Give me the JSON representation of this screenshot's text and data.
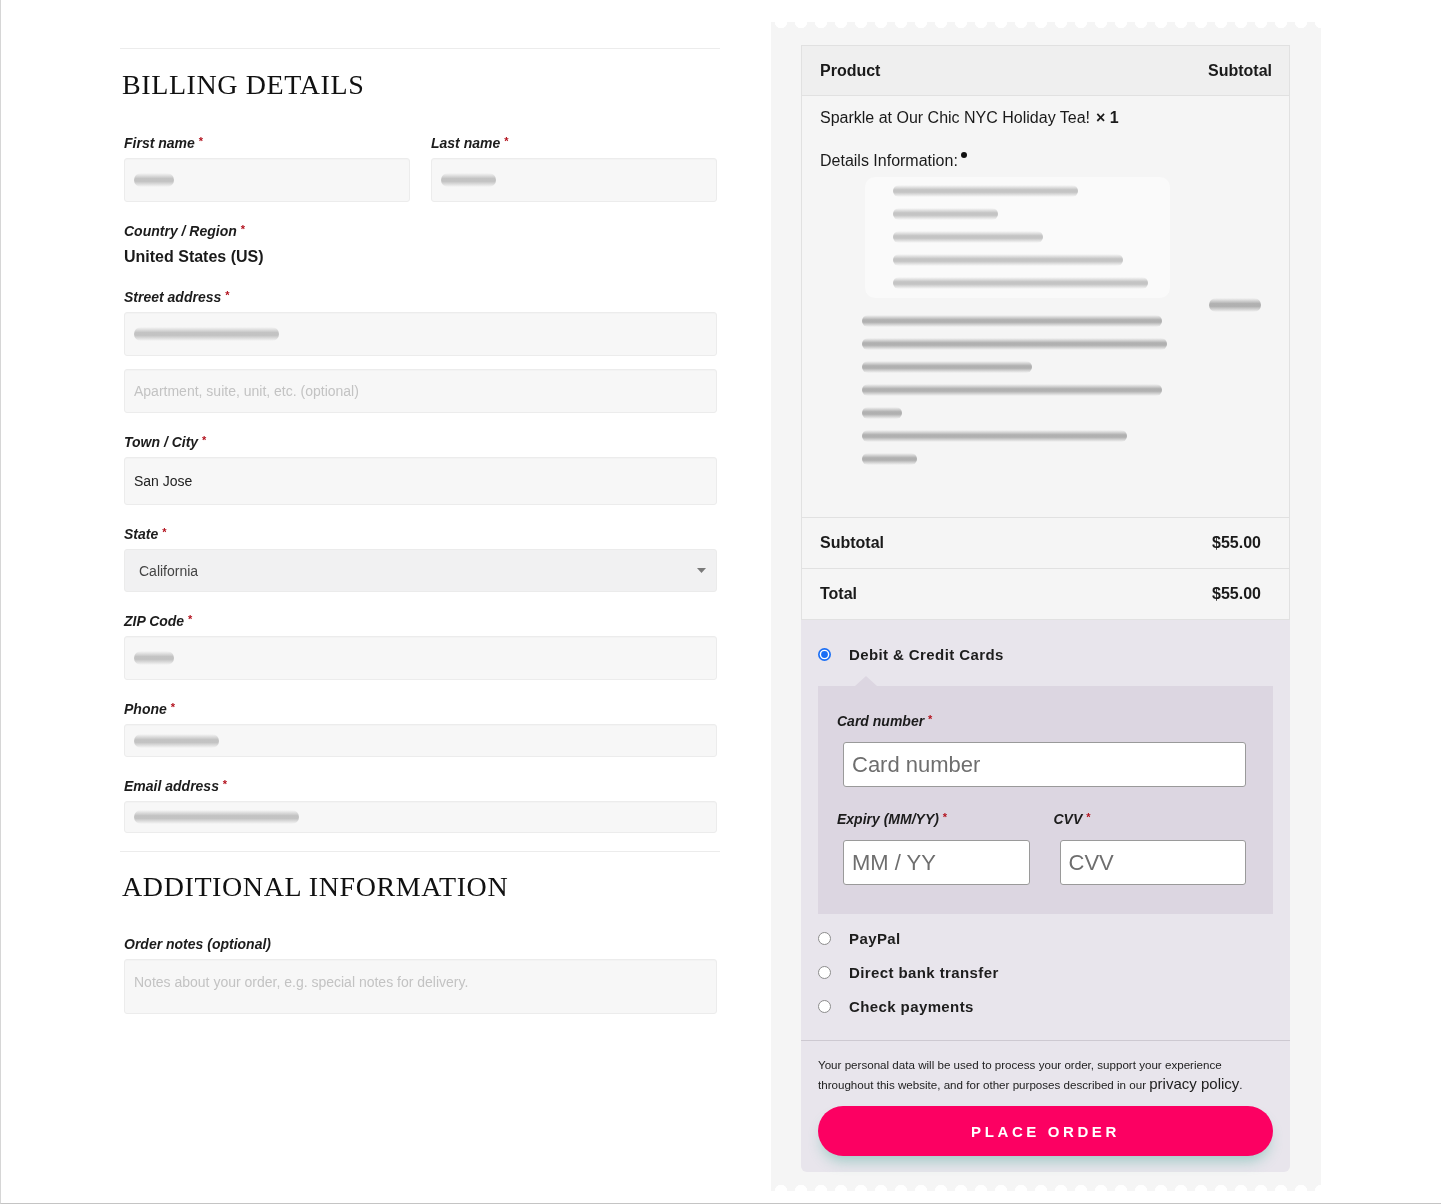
{
  "billing": {
    "title": "BILLING DETAILS",
    "rows": [
      {
        "kind": "pair",
        "fields": [
          {
            "label": "First name",
            "required_mark": "*",
            "blurred": true
          },
          {
            "label": "Last name",
            "required_mark": "*",
            "blurred": true
          }
        ]
      },
      {
        "kind": "static",
        "label": "Country / Region",
        "required_mark": "*",
        "value": "United States (US)"
      },
      {
        "kind": "text",
        "label": "Street address",
        "required_mark": "*",
        "inputs": [
          {
            "blurred": true
          },
          {
            "placeholder": "Apartment, suite, unit, etc. (optional)"
          }
        ]
      },
      {
        "kind": "text",
        "label": "Town / City",
        "required_mark": "*",
        "inputs": [
          {
            "value": "San Jose"
          }
        ]
      },
      {
        "kind": "select",
        "label": "State",
        "required_mark": "*",
        "value": "California"
      },
      {
        "kind": "text",
        "label": "ZIP Code",
        "required_mark": "*",
        "inputs": [
          {
            "blurred": true
          }
        ]
      },
      {
        "kind": "text",
        "label": "Phone",
        "required_mark": "*",
        "inputs": [
          {
            "blurred": true
          }
        ]
      },
      {
        "kind": "text",
        "label": "Email address",
        "required_mark": "*",
        "inputs": [
          {
            "blurred": true
          }
        ]
      }
    ]
  },
  "additional": {
    "title": "ADDITIONAL INFORMATION",
    "notes": {
      "label": "Order notes (optional)",
      "placeholder": "Notes about your order, e.g. special notes for delivery."
    }
  },
  "order": {
    "columns": [
      "Product",
      "Subtotal"
    ],
    "items": [
      {
        "name": "Sparkle at Our Chic NYC Holiday Tea!",
        "quantity": "× 1",
        "details_label": "Details Information:",
        "details_blurred": true,
        "subtotal_blurred": true
      }
    ],
    "totals": [
      {
        "label": "Subtotal",
        "value": "$55.00"
      },
      {
        "label": "Total",
        "value": "$55.00"
      }
    ]
  },
  "payment": {
    "methods": [
      {
        "label": "Debit & Credit Cards",
        "selected": true,
        "card_fields": [
          {
            "kind": "full",
            "label": "Card number",
            "required_mark": "*",
            "placeholder": "Card number"
          },
          {
            "kind": "half",
            "label": "Expiry (MM/YY)",
            "required_mark": "*",
            "placeholder": "MM / YY"
          },
          {
            "kind": "half",
            "label": "CVV",
            "required_mark": "*",
            "placeholder": "CVV"
          }
        ]
      },
      {
        "label": "PayPal",
        "selected": false
      },
      {
        "label": "Direct bank transfer",
        "selected": false
      },
      {
        "label": "Check payments",
        "selected": false
      }
    ],
    "privacy_text": "Your personal data will be used to process your order, support your experience throughout this website, and for other purposes described in our",
    "privacy_link": "privacy policy",
    "privacy_end": ".",
    "button": "PLACE ORDER"
  }
}
